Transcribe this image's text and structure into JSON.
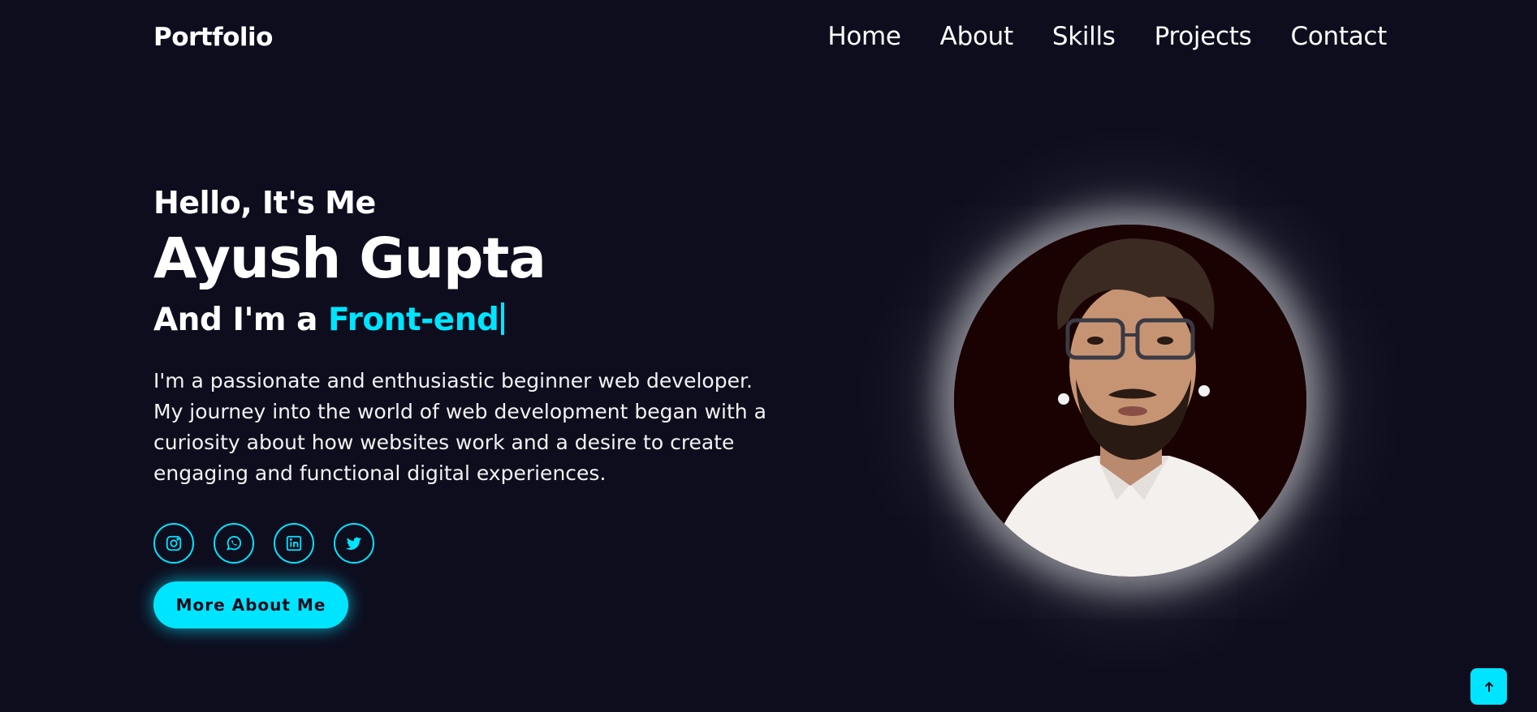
{
  "header": {
    "logo": "Portfolio",
    "nav": [
      {
        "label": "Home"
      },
      {
        "label": "About"
      },
      {
        "label": "Skills"
      },
      {
        "label": "Projects"
      },
      {
        "label": "Contact"
      }
    ]
  },
  "hero": {
    "greeting": "Hello, It's Me",
    "name": "Ayush Gupta",
    "role_prefix": "And I'm a ",
    "role_typed": "Front-end",
    "bio": "I'm a passionate and enthusiastic beginner web developer. My journey into the world of web development began with a curiosity about how websites work and a desire to create engaging and functional digital experiences.",
    "socials": [
      {
        "icon": "instagram-icon"
      },
      {
        "icon": "whatsapp-icon"
      },
      {
        "icon": "linkedin-icon"
      },
      {
        "icon": "twitter-icon"
      }
    ],
    "cta_label": "More About Me"
  },
  "profile_image": {
    "description_icon": "profile-photo"
  },
  "colors": {
    "background": "#0d0d1e",
    "accent": "#00e5ff",
    "text": "#ffffff"
  }
}
